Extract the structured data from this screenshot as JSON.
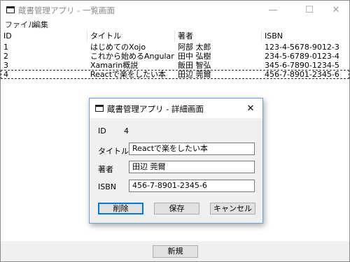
{
  "main_window": {
    "title": "蔵書管理アプリ - 一覧画面",
    "minimize_glyph": "—",
    "maximize_glyph": "☐",
    "close_glyph": "✕",
    "menu": [
      "ファイル",
      "編集"
    ]
  },
  "book_list": {
    "columns": [
      "ID",
      "タイトル",
      "著者",
      "ISBN"
    ],
    "rows": [
      {
        "id": "1",
        "title": "はじめてのXojo",
        "author": "阿部 太郎",
        "isbn": "123-4-5678-9012-3"
      },
      {
        "id": "2",
        "title": "これから始めるAngular",
        "author": "田中 弘樹",
        "isbn": "234-5-6789-0123-4"
      },
      {
        "id": "3",
        "title": "Xamarin概説",
        "author": "飯田 智弘",
        "isbn": "345-6-7890-1234-5"
      },
      {
        "id": "4",
        "title": "Reactで楽をしたい本",
        "author": "田辺 莞爾",
        "isbn": "456-7-8901-2345-6"
      }
    ],
    "selected_row": 4
  },
  "new_button_label": "新規",
  "detail_dialog": {
    "title": "蔵書管理アプリ - 詳細画面",
    "close_glyph": "✕",
    "id_label": "ID",
    "id_value": "4",
    "title_label": "タイトル",
    "title_value": "Reactで楽をしたい本",
    "author_label": "著者",
    "author_value": "田辺 莞爾",
    "isbn_label": "ISBN",
    "isbn_value": "456-7-8901-2345-6",
    "delete_label": "削除",
    "save_label": "保存",
    "cancel_label": "キャンセル"
  },
  "colors": {
    "dialog_border": "#6f9fd8",
    "default_button_border": "#0078d7",
    "window_background": "#f0f0f0"
  }
}
